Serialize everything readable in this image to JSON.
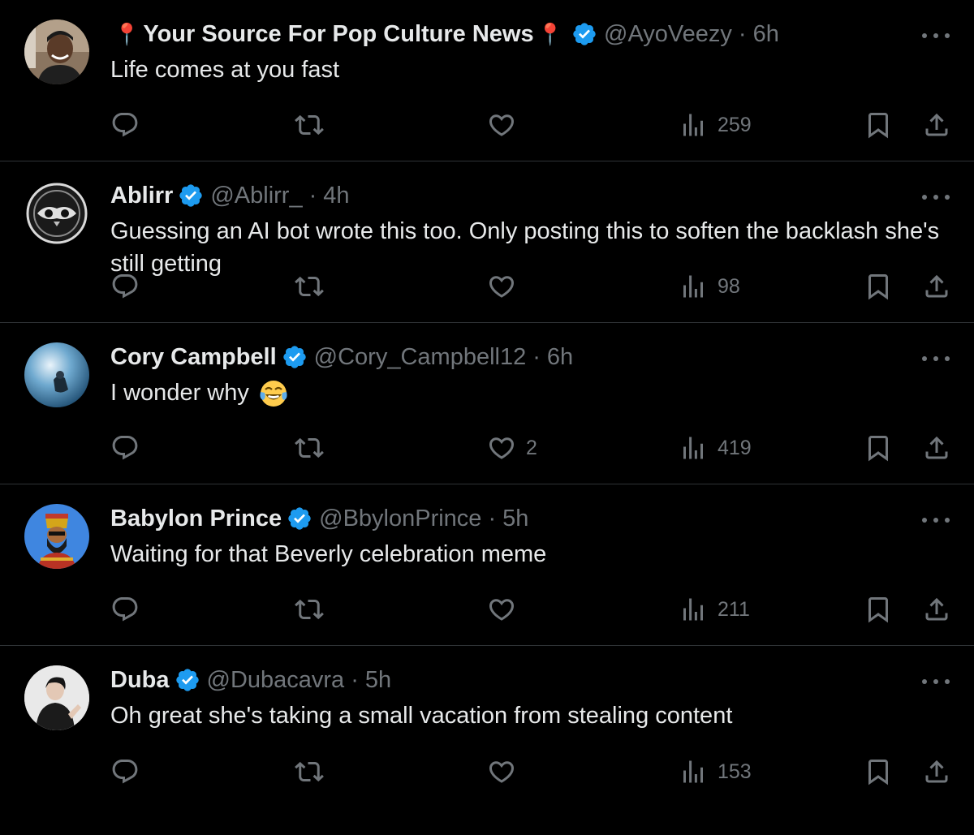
{
  "tweets": [
    {
      "name": "Your Source For Pop Culture News",
      "pin": "📍",
      "handle": "@AyoVeezy",
      "dot": "·",
      "time": "6h",
      "text": "Life comes at you fast",
      "likes": "",
      "views": "259"
    },
    {
      "name": "Ablirr",
      "handle": "@Ablirr_",
      "dot": "·",
      "time": "4h",
      "text": "Guessing an AI bot wrote this too. Only posting this to soften the backlash she's still getting",
      "likes": "",
      "views": "98"
    },
    {
      "name": "Cory Campbell",
      "handle": "@Cory_Campbell12",
      "dot": "·",
      "time": "6h",
      "text": "I wonder why",
      "emoji": "face-with-tears-of-joy",
      "likes": "2",
      "views": "419"
    },
    {
      "name": "Babylon Prince",
      "handle": "@BbylonPrince",
      "dot": "·",
      "time": "5h",
      "text": "Waiting for that Beverly celebration meme",
      "likes": "",
      "views": "211"
    },
    {
      "name": "Duba",
      "handle": "@Dubacavra",
      "dot": "·",
      "time": "5h",
      "text": "Oh great she's taking a small vacation from stealing content",
      "likes": "",
      "views": "153"
    }
  ],
  "icons": {
    "reply": "reply-icon",
    "retweet": "retweet-icon",
    "like": "heart-icon",
    "views": "views-icon",
    "bookmark": "bookmark-icon",
    "share": "share-icon",
    "verified": "verified-badge-icon",
    "more": "more-options-icon"
  },
  "colors": {
    "background": "#000000",
    "text": "#e7e9ea",
    "muted": "#71767b",
    "verified": "#1d9bf0",
    "divider": "#2f3336",
    "pin": "#f4212e"
  }
}
